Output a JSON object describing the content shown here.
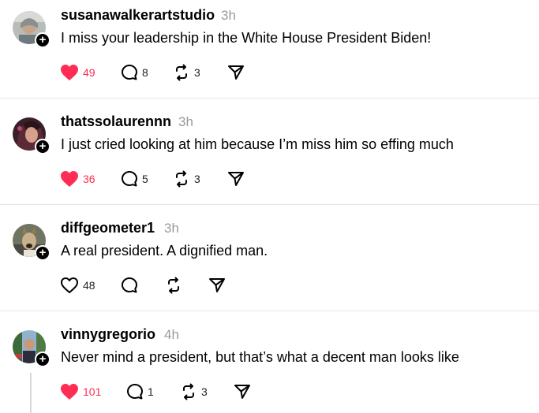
{
  "posts": [
    {
      "username": "susanawalkerartstudio",
      "time": "3h",
      "text": "I miss your leadership in the White House President Biden!",
      "likes": "49",
      "liked": true,
      "replies": "8",
      "reposts": "3"
    },
    {
      "username": "thatssolaurennn",
      "time": "3h",
      "text": "I just cried looking at him because I’m miss him so effing much",
      "likes": "36",
      "liked": true,
      "replies": "5",
      "reposts": "3"
    },
    {
      "username": "diffgeometer1",
      "time": "3h",
      "text": "A real president. A dignified man.",
      "likes": "48",
      "liked": false,
      "replies": "",
      "reposts": ""
    },
    {
      "username": "vinnygregorio",
      "time": "4h",
      "text": "Never mind a president, but that’s what a decent man looks like",
      "likes": "101",
      "liked": true,
      "replies": "1",
      "reposts": "3"
    }
  ],
  "icons": {
    "like": "heart-icon",
    "reply": "comment-icon",
    "repost": "repost-icon",
    "share": "send-icon",
    "follow": "plus-icon"
  },
  "colors": {
    "like_active": "#ff2d55",
    "timestamp": "#9a9a9a",
    "divider": "#e5e5e5"
  },
  "follow_glyph": "+"
}
